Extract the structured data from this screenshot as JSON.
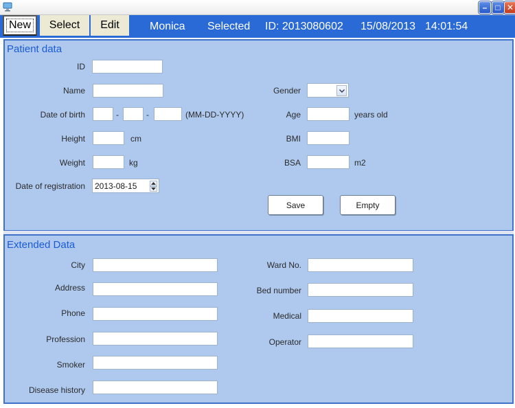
{
  "titlebar": {
    "min": "–",
    "max": "□",
    "close": "✕"
  },
  "menu": {
    "new": "New",
    "select": "Select",
    "edit": "Edit"
  },
  "status": {
    "user": "Monica",
    "selected": "Selected",
    "id_text": "ID: 2013080602",
    "date": "15/08/2013",
    "time": "14:01:54"
  },
  "patient": {
    "title": "Patient data",
    "id_label": "ID",
    "name_label": "Name",
    "dob_label": "Date of birth",
    "dob_sep1": "-",
    "dob_sep2": "-",
    "dob_format": "(MM-DD-YYYY)",
    "height_label": "Height",
    "height_unit": "cm",
    "weight_label": "Weight",
    "weight_unit": "kg",
    "regdate_label": "Date of registration",
    "regdate_value": "2013-08-15",
    "gender_label": "Gender",
    "gender_value": "",
    "age_label": "Age",
    "age_unit": "years old",
    "bmi_label": "BMI",
    "bsa_label": "BSA",
    "bsa_unit": "m2",
    "save": "Save",
    "empty": "Empty"
  },
  "extended": {
    "title": "Extended Data",
    "city_label": "City",
    "address_label": "Address",
    "phone_label": "Phone",
    "profession_label": "Profession",
    "smoker_label": "Smoker",
    "disease_label": "Disease history",
    "ward_label": "Ward No.",
    "bed_label": "Bed number",
    "medical_label": "Medical",
    "operator_label": "Operator"
  },
  "icons": [
    "app-icon",
    "chevron-down-icon",
    "spin-up-icon",
    "spin-down-icon"
  ]
}
